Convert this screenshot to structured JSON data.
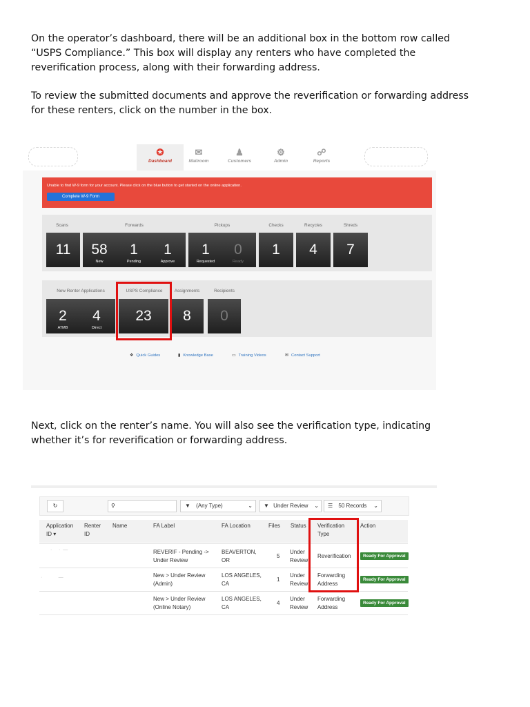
{
  "paragraphs": {
    "p1": [
      "On the operator’s dashboard, there will be an additional box in the bottom row called",
      "“USPS Compliance.” This box will display any renters who have completed the",
      "reverification process, along with their forwarding address."
    ],
    "p2": [
      "To review the submitted documents and approve the reverification or forwarding address",
      "for these renters, click on the number in the box."
    ],
    "p3": [
      "Next, click on the renter’s name. You will also see the verification type, indicating",
      "whether it’s for reverification or forwarding address."
    ]
  },
  "dashboard": {
    "nav": [
      "Dashboard",
      "Mailroom",
      "Customers",
      "Admin",
      "Reports"
    ],
    "alert": {
      "message": "Unable to find W-9 form for your account. Please click on the blue button to get started on the online application.",
      "button": "Complete W-9 Form"
    },
    "row1": {
      "headers": [
        "Scans",
        "Forwards",
        "Pickups",
        "Checks",
        "Recycles",
        "Shreds"
      ],
      "scans": "11",
      "forwards": [
        {
          "n": "58",
          "s": "New"
        },
        {
          "n": "1",
          "s": "Pending"
        },
        {
          "n": "1",
          "s": "Approve"
        }
      ],
      "pickups": [
        {
          "n": "1",
          "s": "Requested"
        },
        {
          "n": "0",
          "s": "Ready"
        }
      ],
      "checks": "1",
      "recycles": "4",
      "shreds": "7"
    },
    "row2": {
      "headers": [
        "New Renter Applications",
        "USPS Compliance",
        "Assignments",
        "Recipients"
      ],
      "applications": [
        {
          "n": "2",
          "s": "ATMB"
        },
        {
          "n": "4",
          "s": "Direct"
        }
      ],
      "usps": "23",
      "assignments": "8",
      "recipients": "0"
    },
    "links": [
      "Quick Guides",
      "Knowledge Base",
      "Training Videos",
      "Contact Support"
    ]
  },
  "table": {
    "toolbar": {
      "type_filter": "(Any Type)",
      "status_filter": "Under Review",
      "records": "50 Records"
    },
    "columns": [
      "Application ID",
      "Renter ID",
      "Name",
      "FA Label",
      "FA Location",
      "Files",
      "Status",
      "Verification Type",
      "Action"
    ],
    "rows": [
      {
        "fa_label": [
          "REVERIF - Pending ->",
          "Under Review"
        ],
        "location": [
          "BEAVERTON,",
          "OR"
        ],
        "files": "5",
        "status": [
          "Under",
          "Review"
        ],
        "vtype": [
          "Reverification"
        ],
        "action": "Ready For Approval"
      },
      {
        "fa_label": [
          "New > Under Review",
          "(Admin)"
        ],
        "location": [
          "LOS ANGELES,",
          "CA"
        ],
        "files": "1",
        "status": [
          "Under",
          "Review"
        ],
        "vtype": [
          "Forwarding",
          "Address"
        ],
        "action": "Ready For Approval"
      },
      {
        "fa_label": [
          "New > Under Review",
          "(Online Notary)"
        ],
        "location": [
          "LOS ANGELES,",
          "CA"
        ],
        "files": "4",
        "status": [
          "Under",
          "Review"
        ],
        "vtype": [
          "Forwarding",
          "Address"
        ],
        "action": "Ready For Approval"
      }
    ]
  }
}
